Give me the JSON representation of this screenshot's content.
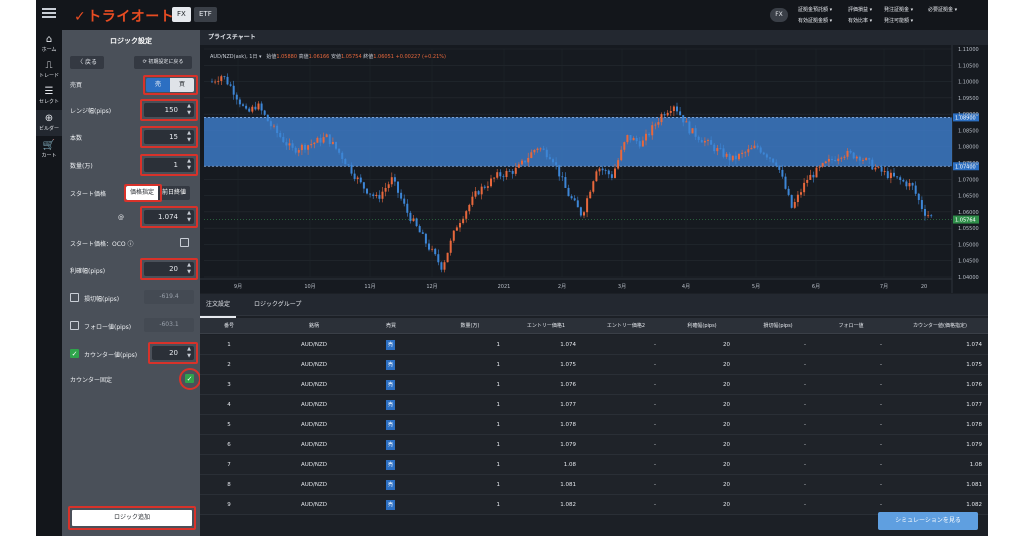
{
  "app": {
    "logo": "トライオート",
    "tab_fx": "FX",
    "tab_etf": "ETF",
    "fx_badge": "FX"
  },
  "top_menu": [
    {
      "label": "証拠金預託額 ▾"
    },
    {
      "label": "評価損益 ▾"
    },
    {
      "label": "発注証拠金 ▾"
    },
    {
      "label": "必要証拠金 ▾"
    },
    {
      "label": "有効証拠金額 ▾"
    },
    {
      "label": "有効比率 ▾"
    },
    {
      "label": "発注可能額 ▾"
    }
  ],
  "nav": [
    {
      "label": "ホーム",
      "icon": "home-icon"
    },
    {
      "label": "トレード",
      "icon": "trade-icon"
    },
    {
      "label": "セレクト",
      "icon": "select-icon"
    },
    {
      "label": "ビルダー",
      "icon": "builder-icon"
    },
    {
      "label": "カート",
      "icon": "cart-icon"
    }
  ],
  "logic": {
    "title": "ロジック設定",
    "back": "〈 戻る",
    "reset": "⟳ 初期設定に戻る",
    "side_label": "売買",
    "sell": "売",
    "buy": "買",
    "range_label": "レンジ幅(pips)",
    "range_value": "150",
    "count_label": "本数",
    "count_value": "15",
    "qty_label": "数量(万)",
    "qty_value": "1",
    "start_label": "スタート価格",
    "start_opt1": "価格指定",
    "start_opt2": "前日終値",
    "at": "@",
    "start_value": "1.074",
    "oco_label": "スタート価格：OCO ⓘ",
    "tp_label": "利確幅(pips)",
    "tp_value": "20",
    "sl_label": "損切幅(pips)",
    "sl_value": "-619.4",
    "follow_label": "フォロー値(pips)",
    "follow_value": "-603.1",
    "counter_label": "カウンター値(pips)",
    "counter_value": "20",
    "counter_fixed_label": "カウンター固定",
    "add": "ロジック追加"
  },
  "chart_tab": "プライスチャート",
  "ohlc": {
    "symbol": "AUD/NZD(ask), 1日 ▾",
    "open_l": "始値",
    "open": "1.05880",
    "high_l": "高値",
    "high": "1.06166",
    "low_l": "安値",
    "low": "1.05754",
    "close_l": "終値",
    "close": "1.06051",
    "change": "+0.00227 (+0.21%)"
  },
  "chart_data": {
    "type": "candlestick",
    "y_ticks": [
      "1.11000",
      "1.10500",
      "1.10000",
      "1.09500",
      "1.09000",
      "1.08500",
      "1.08000",
      "1.07500",
      "1.07000",
      "1.06500",
      "1.06000",
      "1.05500",
      "1.05000",
      "1.04500",
      "1.04000"
    ],
    "ylim": [
      1.04,
      1.11
    ],
    "x_labels": [
      "9月",
      "10月",
      "11月",
      "12月",
      "2021",
      "2月",
      "3月",
      "4月",
      "5月",
      "6月",
      "7月",
      "20"
    ],
    "range_band": [
      1.074,
      1.089
    ],
    "band_labels": [
      "1.08900",
      "1.07400"
    ],
    "last_price": "1.05764",
    "last_price_value": 1.05764
  },
  "tabs": [
    "注文設定",
    "ロジックグループ"
  ],
  "columns": [
    "番号",
    "銘柄",
    "売買",
    "数量(万)",
    "エントリー価格1",
    "エントリー価格2",
    "利確幅(pips)",
    "損切幅(pips)",
    "フォロー値",
    "カウンター値(価格指定)"
  ],
  "rows": [
    {
      "n": "1",
      "pair": "AUD/NZD",
      "side": "売",
      "qty": "1",
      "e1": "1.074",
      "e2": "-",
      "tp": "20",
      "sl": "-",
      "fol": "-",
      "cnt": "1.074"
    },
    {
      "n": "2",
      "pair": "AUD/NZD",
      "side": "売",
      "qty": "1",
      "e1": "1.075",
      "e2": "-",
      "tp": "20",
      "sl": "-",
      "fol": "-",
      "cnt": "1.075"
    },
    {
      "n": "3",
      "pair": "AUD/NZD",
      "side": "売",
      "qty": "1",
      "e1": "1.076",
      "e2": "-",
      "tp": "20",
      "sl": "-",
      "fol": "-",
      "cnt": "1.076"
    },
    {
      "n": "4",
      "pair": "AUD/NZD",
      "side": "売",
      "qty": "1",
      "e1": "1.077",
      "e2": "-",
      "tp": "20",
      "sl": "-",
      "fol": "-",
      "cnt": "1.077"
    },
    {
      "n": "5",
      "pair": "AUD/NZD",
      "side": "売",
      "qty": "1",
      "e1": "1.078",
      "e2": "-",
      "tp": "20",
      "sl": "-",
      "fol": "-",
      "cnt": "1.078"
    },
    {
      "n": "6",
      "pair": "AUD/NZD",
      "side": "売",
      "qty": "1",
      "e1": "1.079",
      "e2": "-",
      "tp": "20",
      "sl": "-",
      "fol": "-",
      "cnt": "1.079"
    },
    {
      "n": "7",
      "pair": "AUD/NZD",
      "side": "売",
      "qty": "1",
      "e1": "1.08",
      "e2": "-",
      "tp": "20",
      "sl": "-",
      "fol": "-",
      "cnt": "1.08"
    },
    {
      "n": "8",
      "pair": "AUD/NZD",
      "side": "売",
      "qty": "1",
      "e1": "1.081",
      "e2": "-",
      "tp": "20",
      "sl": "-",
      "fol": "-",
      "cnt": "1.081"
    },
    {
      "n": "9",
      "pair": "AUD/NZD",
      "side": "売",
      "qty": "1",
      "e1": "1.082",
      "e2": "-",
      "tp": "20",
      "sl": "-",
      "fol": "-",
      "cnt": "1.082"
    }
  ],
  "sim_button": "シミュレーションを見る",
  "colors": {
    "up": "#e8683c",
    "down": "#3d86d6",
    "band": "#3f7fd0",
    "highlight": "#d8322a",
    "accent": "#2c6fc2"
  }
}
